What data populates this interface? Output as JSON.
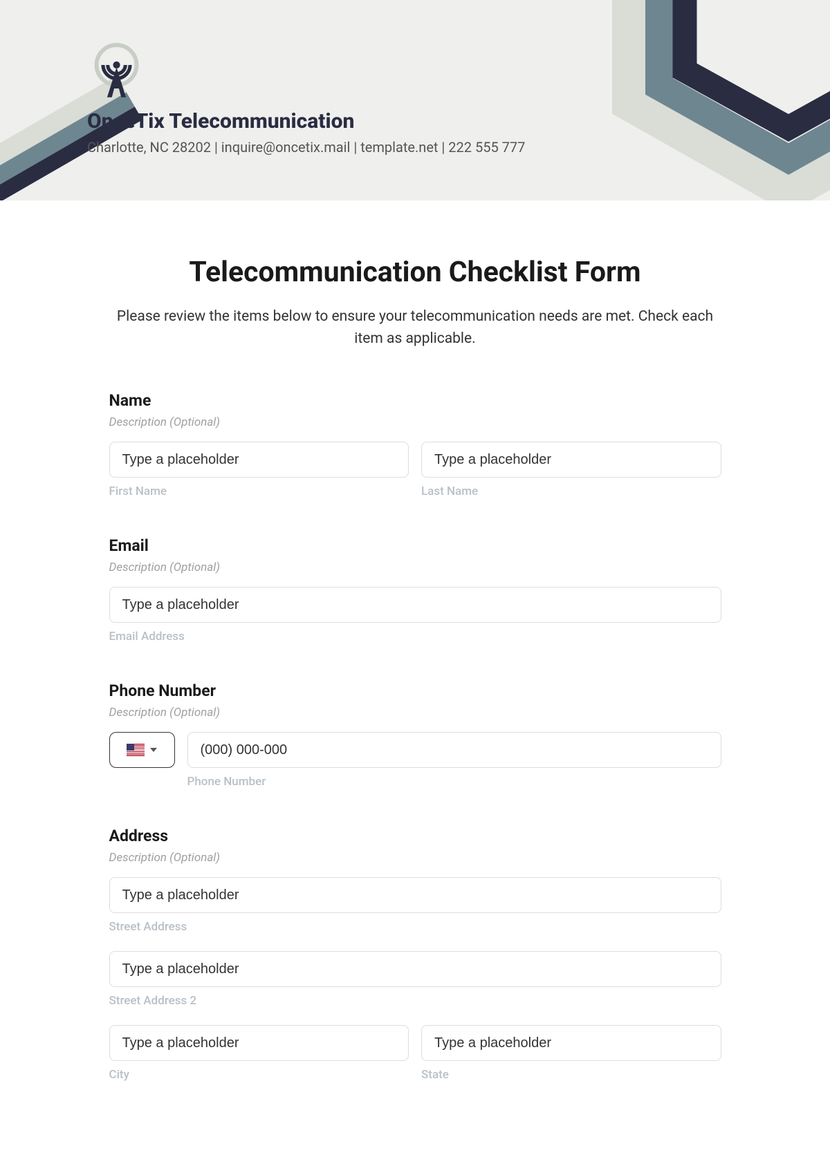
{
  "header": {
    "company_name": "OnceTix Telecommunication",
    "company_info": "Charlotte, NC 28202 | inquire@oncetix.mail | template.net | 222 555 777"
  },
  "form": {
    "title": "Telecommunication Checklist Form",
    "subtitle": "Please review the items below to ensure your telecommunication needs are met. Check each item as applicable."
  },
  "name": {
    "label": "Name",
    "desc": "Description (Optional)",
    "first_placeholder": "Type a placeholder",
    "first_sublabel": "First Name",
    "last_placeholder": "Type a placeholder",
    "last_sublabel": "Last Name"
  },
  "email": {
    "label": "Email",
    "desc": "Description (Optional)",
    "placeholder": "Type a placeholder",
    "sublabel": "Email Address"
  },
  "phone": {
    "label": "Phone Number",
    "desc": "Description (Optional)",
    "placeholder": "(000) 000-000",
    "sublabel": "Phone Number"
  },
  "address": {
    "label": "Address",
    "desc": "Description (Optional)",
    "street_placeholder": "Type a placeholder",
    "street_sublabel": "Street Address",
    "street2_placeholder": "Type a placeholder",
    "street2_sublabel": "Street Address 2",
    "city_placeholder": "Type a placeholder",
    "city_sublabel": "City",
    "state_placeholder": "Type a placeholder",
    "state_sublabel": "State"
  }
}
